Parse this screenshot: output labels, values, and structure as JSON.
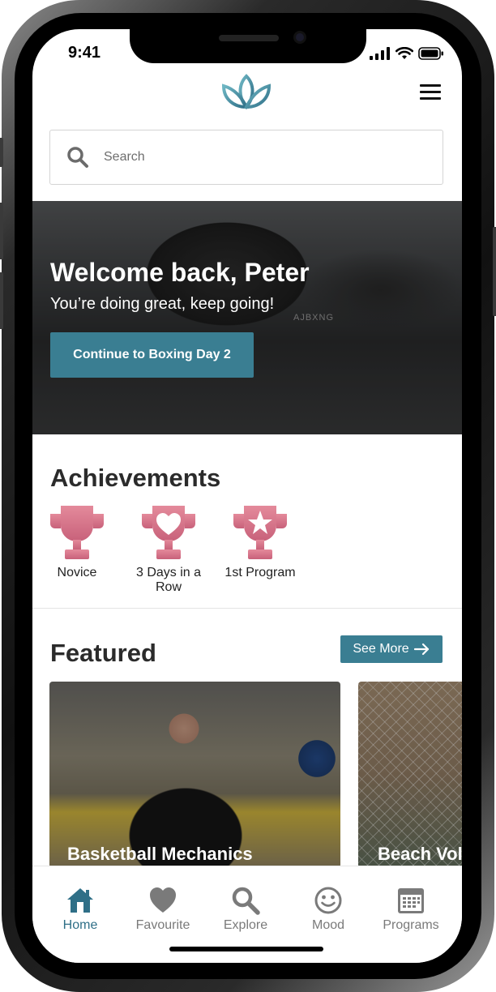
{
  "status_bar": {
    "time": "9:41"
  },
  "header": {
    "logo_icon": "lotus-icon",
    "menu_icon": "hamburger-menu-icon"
  },
  "search": {
    "placeholder": "Search",
    "value": ""
  },
  "hero": {
    "title": "Welcome back, Peter",
    "subtitle": "You’re doing great, keep going!",
    "button_label": "Continue to Boxing Day 2",
    "image_brand_text": "AJBXNG"
  },
  "achievements": {
    "title": "Achievements",
    "items": [
      {
        "label": "Novice",
        "icon": "trophy-icon"
      },
      {
        "label": "3 Days in a Row",
        "icon": "trophy-heart-icon"
      },
      {
        "label": "1st Program",
        "icon": "trophy-star-icon"
      }
    ]
  },
  "featured": {
    "title": "Featured",
    "see_more_label": "See More",
    "cards": [
      {
        "title": "Basketball Mechanics"
      },
      {
        "title": "Beach Voll"
      }
    ]
  },
  "bottom_nav": {
    "items": [
      {
        "label": "Home",
        "icon": "home-icon",
        "active": true
      },
      {
        "label": "Favourite",
        "icon": "heart-icon",
        "active": false
      },
      {
        "label": "Explore",
        "icon": "search-icon",
        "active": false
      },
      {
        "label": "Mood",
        "icon": "smiley-icon",
        "active": false
      },
      {
        "label": "Programs",
        "icon": "calendar-icon",
        "active": false
      }
    ]
  },
  "colors": {
    "accent": "#3a7e92",
    "achievement": "#d8768a",
    "nav_active": "#2f6f87",
    "nav_inactive": "#7a7a7a"
  }
}
